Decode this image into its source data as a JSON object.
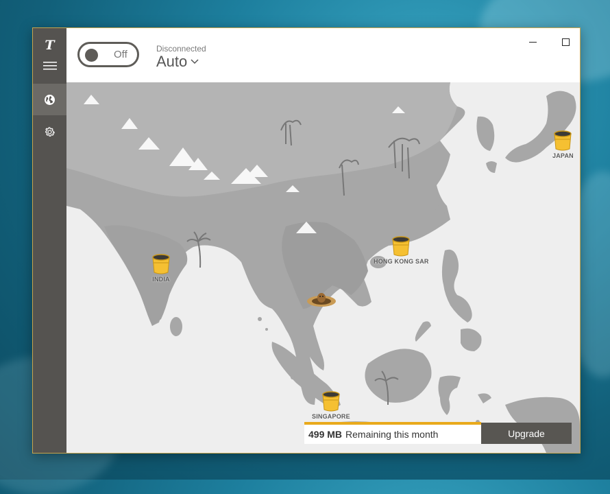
{
  "window": {
    "sidebar": {
      "logo": "T",
      "items": [
        {
          "name": "menu",
          "icon": "hamburger-menu-icon"
        },
        {
          "name": "map",
          "icon": "globe-icon",
          "active": true
        },
        {
          "name": "settings",
          "icon": "gear-icon"
        }
      ]
    },
    "header": {
      "toggle_label": "Off",
      "toggle_on": false,
      "status": "Disconnected",
      "location": "Auto",
      "location_icon": "chevron-down-icon"
    },
    "controls": {
      "minimize_icon": "minimize-icon",
      "maximize_icon": "maximize-icon",
      "close_icon": "close-icon"
    }
  },
  "map": {
    "locations": [
      "JAPAN",
      "HONG KONG SAR",
      "INDIA",
      "SINGAPORE"
    ]
  },
  "footer": {
    "data_amount": "499 MB",
    "data_text": "Remaining this month",
    "upgrade_label": "Upgrade"
  },
  "colors": {
    "sidebar": "#555350",
    "accent": "#e9aa1c",
    "barrel": "#f5c032",
    "map_land": "#a9a9a9",
    "map_sea": "#eeeeee"
  }
}
